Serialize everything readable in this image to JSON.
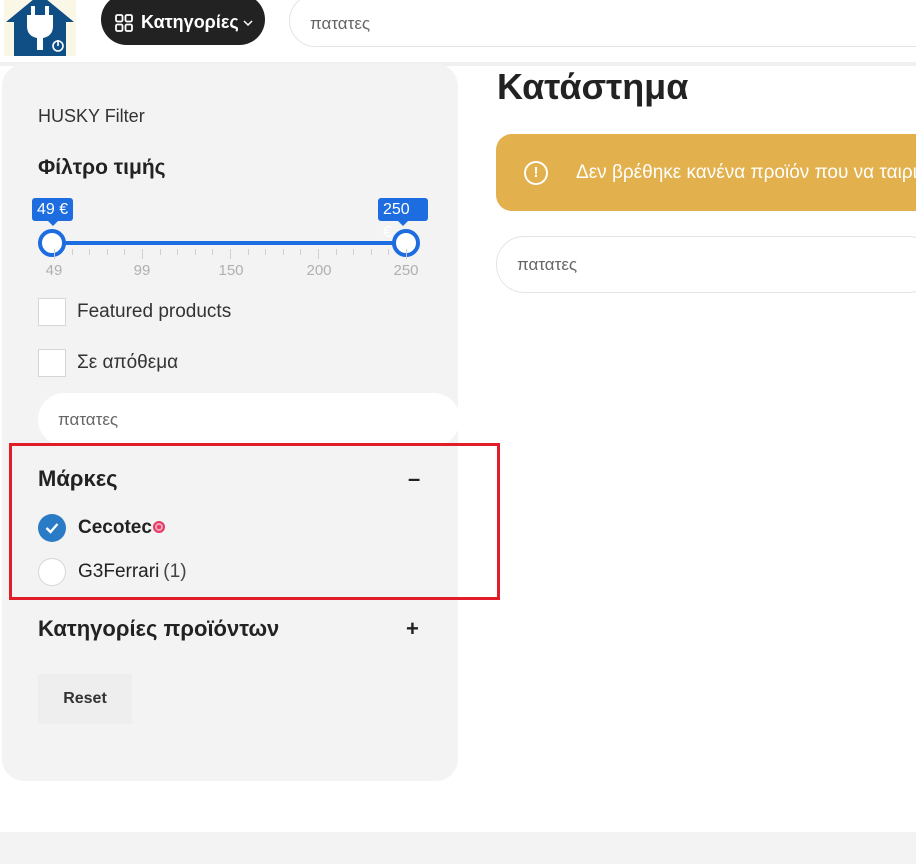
{
  "header": {
    "categories_label": "Κατηγορίες",
    "search_value": "πατατες"
  },
  "sidebar": {
    "title": "HUSKY Filter",
    "price_filter": {
      "title": "Φίλτρο τιμής",
      "min_label": "49 €",
      "max_label": "250 €",
      "min_value": 49,
      "max_value": 250,
      "scale": [
        "49",
        "99",
        "150",
        "200",
        "250"
      ]
    },
    "featured_label": "Featured products",
    "in_stock_label": "Σε απόθεμα",
    "search_value": "πατατες",
    "brands": {
      "title": "Μάρκες",
      "toggle": "–",
      "items": [
        {
          "label": "Cecotec",
          "count": "",
          "checked": true
        },
        {
          "label": "G3Ferrari",
          "count": "(1)",
          "checked": false
        }
      ]
    },
    "product_categories": {
      "title": "Κατηγορίες προϊόντων",
      "toggle": "+"
    },
    "reset_label": "Reset"
  },
  "main": {
    "title": "Κατάστημα",
    "notice": "Δεν βρέθηκε κανένα προϊόν που να ταιριάζει με την αναζήτησή σας.",
    "search_value": "πατατες"
  },
  "colors": {
    "accent": "#1d6de0",
    "notice_bg": "#e2b04c",
    "highlight": "#e11d2a",
    "checked_radio": "#2a7bc5"
  }
}
